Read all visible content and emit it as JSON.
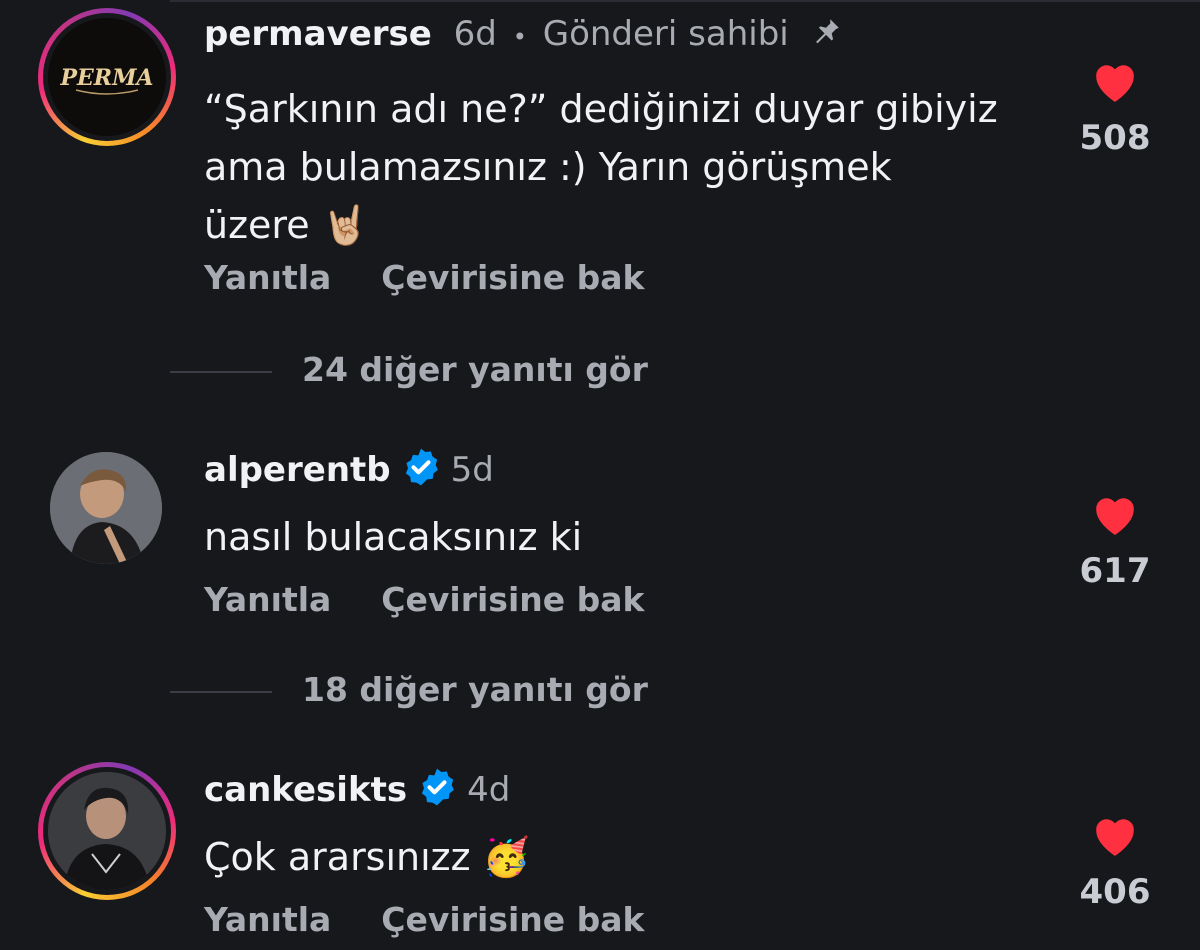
{
  "comments": [
    {
      "username": "permaverse",
      "time": "6d",
      "separator": "•",
      "author_badge": "Gönderi sahibi",
      "avatar_text": "PERMA",
      "text": "“Şarkının adı ne?” dediğinizi duyar gibiyiz ama bulamazsınız :) Yarın görüşmek üzere 🤘🏼",
      "reply_label": "Yanıtla",
      "translate_label": "Çevirisine bak",
      "likes": "508",
      "more_replies": "24 diğer yanıtı gör"
    },
    {
      "username": "alperentb",
      "time": "5d",
      "text": "nasıl bulacaksınız ki",
      "reply_label": "Yanıtla",
      "translate_label": "Çevirisine bak",
      "likes": "617",
      "more_replies": "18 diğer yanıtı gör"
    },
    {
      "username": "cankesikts",
      "time": "4d",
      "text": "Çok ararsınızz 🥳",
      "reply_label": "Yanıtla",
      "translate_label": "Çevirisine bak",
      "likes": "406"
    }
  ],
  "colors": {
    "background": "#16181c",
    "heart": "#ff3040",
    "verified": "#0095f6",
    "muted": "#a8abb2"
  },
  "icons": [
    "pin-icon",
    "verified-badge-icon",
    "heart-icon"
  ]
}
